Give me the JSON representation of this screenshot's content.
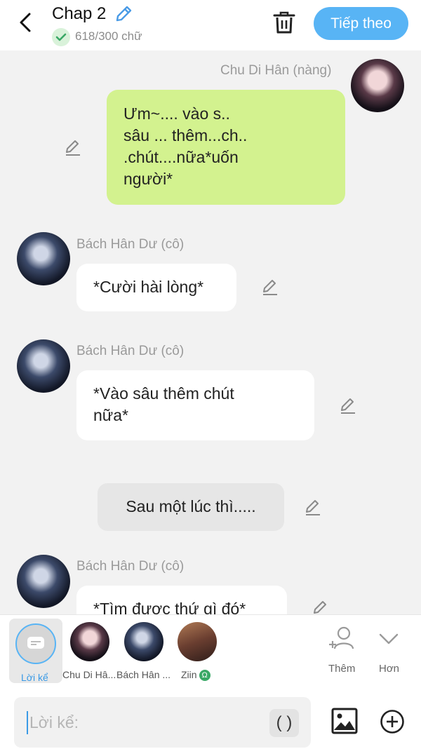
{
  "header": {
    "title": "Chap 2",
    "word_count": "618/300 chữ",
    "next_label": "Tiếp theo"
  },
  "messages": [
    {
      "speaker": "Chu Di Hân (nàng)",
      "text_lines": [
        "Ưm~.... vào s..",
        "sâu ... thêm...ch..",
        ".chút....nữa*uốn",
        "người*"
      ]
    },
    {
      "speaker": "Bách Hân Dư (cô)",
      "text_lines": [
        "*Cười hài lòng*"
      ]
    },
    {
      "speaker": "Bách Hân Dư (cô)",
      "text_lines": [
        "*Vào sâu thêm chút",
        "nữa*"
      ]
    },
    {
      "narration": "Sau một lúc thì....."
    },
    {
      "speaker": "Bách Hân Dư (cô)",
      "text_lines": [
        "*Tìm được thứ gì đó*"
      ]
    }
  ],
  "characters": [
    {
      "label": "Lời kể",
      "selected": true
    },
    {
      "label": "Chu Di Hâ..."
    },
    {
      "label": "Bách Hân ..."
    },
    {
      "label": "Ziin",
      "badge": "Ω"
    }
  ],
  "tools": {
    "add_label": "Thêm",
    "more_label": "Hơn"
  },
  "input": {
    "placeholder": "Lời kể:",
    "paren_label": "( )"
  },
  "colors": {
    "accent": "#58b4f5",
    "own_bubble": "#d3f28f",
    "other_bubble": "#ffffff",
    "narration_bubble": "#e6e6e6",
    "background": "#f2f2f2"
  }
}
